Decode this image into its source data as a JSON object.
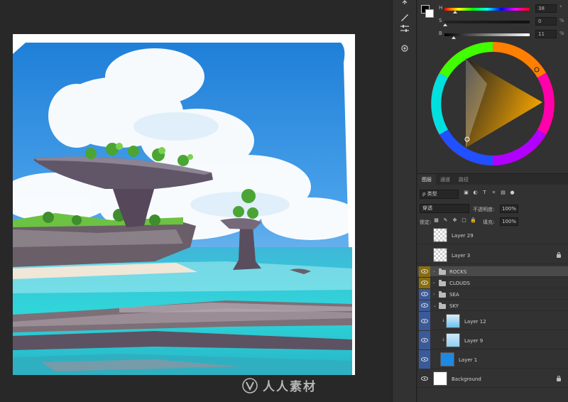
{
  "colors": {
    "eye_col_yellow": "#8a6d10",
    "eye_col_blue": "#3b5a99",
    "row_selected": "#4a4a4a"
  },
  "color_panel": {
    "sliders": [
      {
        "label": "H",
        "value": "38",
        "unit": "°"
      },
      {
        "label": "S",
        "value": "0",
        "unit": "%"
      },
      {
        "label": "B",
        "value": "11",
        "unit": "%"
      }
    ]
  },
  "layers_panel": {
    "tabs": [
      "图层",
      "通道",
      "路径"
    ],
    "filter_label": "ρ 类型",
    "blend_mode": "穿透",
    "opacity_label": "不透明度:",
    "opacity_value": "100%",
    "lock_label": "锁定:",
    "fill_label": "填充:",
    "fill_value": "100%",
    "layers": [
      {
        "name": "Layer 29",
        "type": "layer"
      },
      {
        "name": "Layer 3",
        "type": "layer",
        "locked": true
      },
      {
        "name": "ROCKS",
        "type": "folder"
      },
      {
        "name": "CLOUDS",
        "type": "folder"
      },
      {
        "name": "SEA",
        "type": "folder"
      },
      {
        "name": "SKY",
        "type": "folder-open"
      },
      {
        "name": "Layer 12",
        "type": "layer"
      },
      {
        "name": "Layer 9",
        "type": "layer"
      },
      {
        "name": "Layer 1",
        "type": "layer"
      },
      {
        "name": "Background",
        "type": "background",
        "locked": true
      }
    ]
  },
  "watermark": {
    "text": "人人素材"
  }
}
